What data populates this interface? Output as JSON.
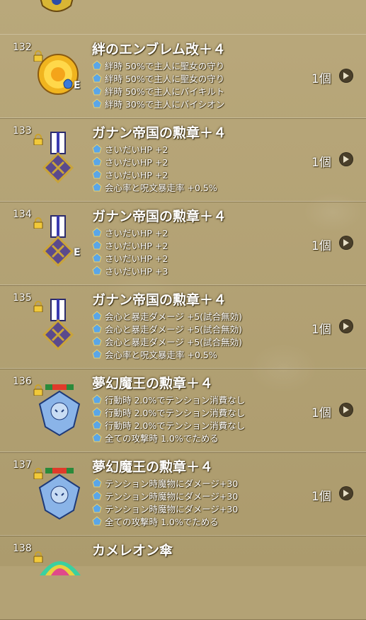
{
  "items": [
    {
      "num": "132",
      "name": "絆のエンブレム改＋４",
      "equipped": true,
      "equip_mark": "E",
      "icon": "sun-emblem-icon",
      "effects": [
        "絆時 50%で主人に聖女の守り",
        "絆時 50%で主人に聖女の守り",
        "絆時 50%で主人にバイキルト",
        "絆時 30%で主人にバイシオン"
      ],
      "count": "1個"
    },
    {
      "num": "133",
      "name": "ガナン帝国の勲章＋４",
      "equipped": false,
      "icon": "ganan-medal-icon",
      "effects": [
        "さいだいHP +2",
        "さいだいHP +2",
        "さいだいHP +2",
        "会心率と呪文暴走率 +0.5%"
      ],
      "count": "1個"
    },
    {
      "num": "134",
      "name": "ガナン帝国の勲章＋４",
      "equipped": true,
      "equip_mark": "E",
      "icon": "ganan-medal-icon",
      "effects": [
        "さいだいHP +2",
        "さいだいHP +2",
        "さいだいHP +2",
        "さいだいHP +3"
      ],
      "count": "1個"
    },
    {
      "num": "135",
      "name": "ガナン帝国の勲章＋４",
      "equipped": false,
      "icon": "ganan-medal-icon",
      "effects": [
        "会心と暴走ダメージ +5(試合無効)",
        "会心と暴走ダメージ +5(試合無効)",
        "会心と暴走ダメージ +5(試合無効)",
        "会心率と呪文暴走率 +0.5%"
      ],
      "count": "1個"
    },
    {
      "num": "136",
      "name": "夢幻魔王の勲章＋４",
      "equipped": false,
      "icon": "demon-king-medal-icon",
      "effects": [
        "行動時 2.0%でテンション消費なし",
        "行動時 2.0%でテンション消費なし",
        "行動時 2.0%でテンション消費なし",
        "全ての攻撃時 1.0%でためる"
      ],
      "count": "1個"
    },
    {
      "num": "137",
      "name": "夢幻魔王の勲章＋４",
      "equipped": false,
      "icon": "demon-king-medal-icon",
      "effects": [
        "テンション時魔物にダメージ+30",
        "テンション時魔物にダメージ+30",
        "テンション時魔物にダメージ+30",
        "全ての攻撃時 1.0%でためる"
      ],
      "count": "1個"
    },
    {
      "num": "138",
      "name": "カメレオン傘",
      "equipped": false,
      "icon": "chameleon-umbrella-icon",
      "effects": [],
      "count": ""
    }
  ],
  "colors": {
    "background": "#b3a275",
    "text": "#ffffff",
    "arrow_bg": "#4a3f2a"
  }
}
